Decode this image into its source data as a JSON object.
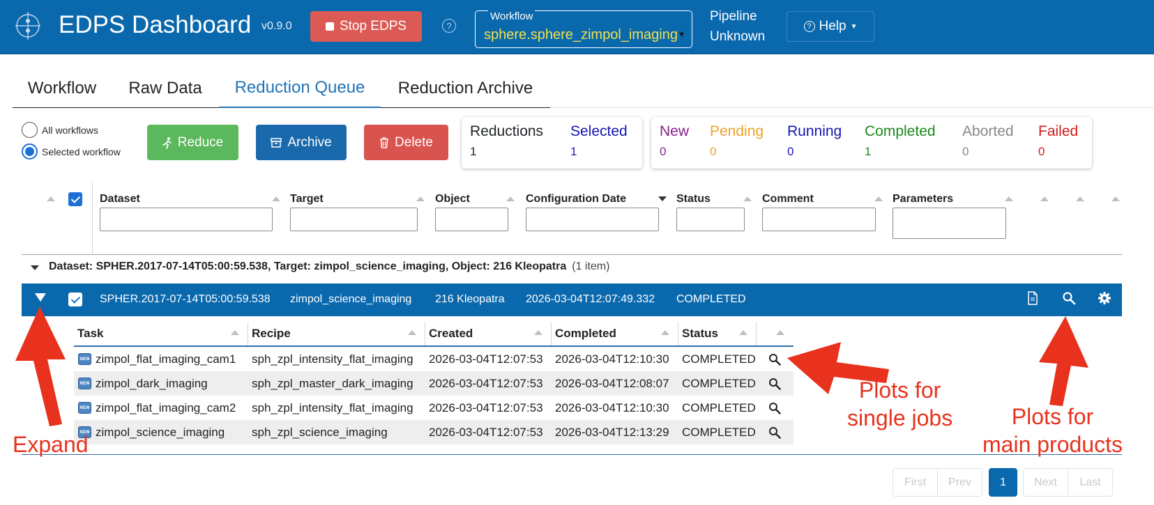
{
  "header": {
    "title": "EDPS Dashboard",
    "version": "v0.9.0",
    "stop_label": "Stop EDPS",
    "help_glyph": "?",
    "workflow_label": "Workflow",
    "workflow_value": "sphere.sphere_zimpol_imaging",
    "pipeline_label": "Pipeline",
    "pipeline_value": "Unknown",
    "help_label": "Help"
  },
  "tabs": [
    {
      "label": "Workflow",
      "active": false
    },
    {
      "label": "Raw Data",
      "active": false
    },
    {
      "label": "Reduction Queue",
      "active": true
    },
    {
      "label": "Reduction Archive",
      "active": false
    }
  ],
  "filters": {
    "all_workflows": "All workflows",
    "selected_workflow": "Selected workflow",
    "selected": "selected_workflow"
  },
  "actions": {
    "reduce": "Reduce",
    "archive": "Archive",
    "delete": "Delete"
  },
  "stats": {
    "reductions_label": "Reductions",
    "reductions_value": "1",
    "selected_label": "Selected",
    "selected_value": "1",
    "new_label": "New",
    "new_value": "0",
    "pending_label": "Pending",
    "pending_value": "0",
    "running_label": "Running",
    "running_value": "0",
    "completed_label": "Completed",
    "completed_value": "1",
    "aborted_label": "Aborted",
    "aborted_value": "0",
    "failed_label": "Failed",
    "failed_value": "0"
  },
  "colors": {
    "header_bg": "#0a68ad",
    "reduce": "#5cb85c",
    "archive": "#1a69ac",
    "delete": "#d9534f",
    "new": "#8a1f8d",
    "pending": "#f0a12a",
    "running": "#1515b5",
    "completed": "#1a8a1a",
    "aborted": "#888888",
    "failed": "#d11a1a",
    "annotation": "#e8321d"
  },
  "table": {
    "columns": [
      "Dataset",
      "Target",
      "Object",
      "Configuration Date",
      "Status",
      "Comment",
      "Parameters"
    ],
    "group_label": "Dataset: SPHER.2017-07-14T05:00:59.538, Target: zimpol_science_imaging, Object: 216 Kleopatra",
    "group_count": "(1 item)",
    "row": {
      "dataset": "SPHER.2017-07-14T05:00:59.538",
      "target": "zimpol_science_imaging",
      "object": "216 Kleopatra",
      "config_date": "2026-03-04T12:07:49.332",
      "status": "COMPLETED"
    }
  },
  "jobs": {
    "columns": [
      "Task",
      "Recipe",
      "Created",
      "Completed",
      "Status"
    ],
    "badge": "NEW",
    "rows": [
      {
        "task": "zimpol_flat_imaging_cam1",
        "recipe": "sph_zpl_intensity_flat_imaging",
        "created": "2026-03-04T12:07:53",
        "completed": "2026-03-04T12:10:30",
        "status": "COMPLETED"
      },
      {
        "task": "zimpol_dark_imaging",
        "recipe": "sph_zpl_master_dark_imaging",
        "created": "2026-03-04T12:07:53",
        "completed": "2026-03-04T12:08:07",
        "status": "COMPLETED"
      },
      {
        "task": "zimpol_flat_imaging_cam2",
        "recipe": "sph_zpl_intensity_flat_imaging",
        "created": "2026-03-04T12:07:53",
        "completed": "2026-03-04T12:10:30",
        "status": "COMPLETED"
      },
      {
        "task": "zimpol_science_imaging",
        "recipe": "sph_zpl_science_imaging",
        "created": "2026-03-04T12:07:53",
        "completed": "2026-03-04T12:13:29",
        "status": "COMPLETED"
      }
    ]
  },
  "pagination": {
    "first": "First",
    "prev": "Prev",
    "current": "1",
    "next": "Next",
    "last": "Last"
  },
  "annotations": {
    "expand": "Expand",
    "single_jobs_line1": "Plots for",
    "single_jobs_line2": "single jobs",
    "main_products_line1": "Plots for",
    "main_products_line2": "main products"
  }
}
